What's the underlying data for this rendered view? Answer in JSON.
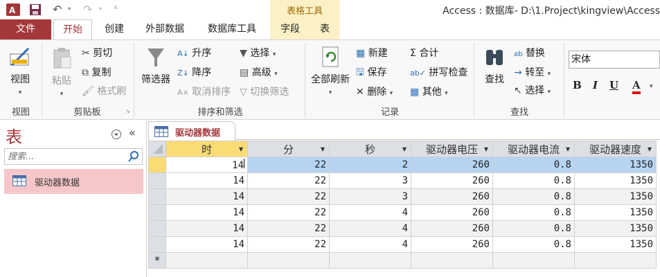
{
  "titlebar": {
    "title": "Access : 数据库- D:\\1.Project\\kingview\\Access",
    "context_group": "表格工具",
    "app_icon": "access-logo-icon"
  },
  "tabs": {
    "file": "文件",
    "home": "开始",
    "create": "创建",
    "external": "外部数据",
    "dbtools": "数据库工具",
    "fields": "字段",
    "table": "表"
  },
  "ribbon": {
    "view": {
      "button": "视图",
      "group": "视图"
    },
    "clipboard": {
      "paste": "粘贴",
      "cut": "剪切",
      "copy": "复制",
      "format_painter": "格式刷",
      "group": "剪贴板"
    },
    "sort_filter": {
      "filter": "筛选器",
      "ascending": "升序",
      "descending": "降序",
      "remove_sort": "取消排序",
      "selection": "选择",
      "advanced": "高级",
      "toggle_filter": "切换筛选",
      "group": "排序和筛选"
    },
    "records": {
      "refresh_all": "全部刷新",
      "new": "新建",
      "save": "保存",
      "delete": "删除",
      "totals": "合计",
      "spelling": "拼写检查",
      "more": "其他",
      "group": "记录"
    },
    "find": {
      "find": "查找",
      "replace": "替换",
      "goto": "转至",
      "select": "选择",
      "group": "查找"
    },
    "text_format": {
      "font_name": "宋体",
      "bold": "B",
      "italic": "I",
      "underline": "U",
      "font_color": "A"
    }
  },
  "nav": {
    "title": "表",
    "search_placeholder": "搜索...",
    "items": [
      {
        "label": "驱动器数据"
      }
    ]
  },
  "object_tab": {
    "label": "驱动器数据"
  },
  "datasheet": {
    "columns": [
      "时",
      "分",
      "秒",
      "驱动器电压",
      "驱动器电流",
      "驱动器速度"
    ],
    "rows": [
      [
        "14",
        "22",
        "2",
        "260",
        "0.8",
        "1350"
      ],
      [
        "14",
        "22",
        "3",
        "260",
        "0.8",
        "1350"
      ],
      [
        "14",
        "22",
        "3",
        "260",
        "0.8",
        "1350"
      ],
      [
        "14",
        "22",
        "4",
        "260",
        "0.8",
        "1350"
      ],
      [
        "14",
        "22",
        "4",
        "260",
        "0.8",
        "1350"
      ],
      [
        "14",
        "22",
        "4",
        "260",
        "0.8",
        "1350"
      ]
    ],
    "new_row_marker": "*"
  },
  "colors": {
    "accent": "#a4373a",
    "selected_header": "#fbdc74",
    "selected_row": "#b6d4f2",
    "nav_selected": "#f6c7c9"
  }
}
